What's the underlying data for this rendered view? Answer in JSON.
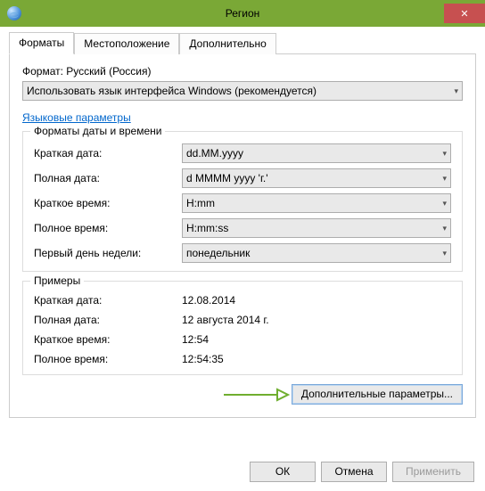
{
  "window": {
    "title": "Регион"
  },
  "tabs": [
    {
      "label": "Форматы",
      "active": true
    },
    {
      "label": "Местоположение",
      "active": false
    },
    {
      "label": "Дополнительно",
      "active": false
    }
  ],
  "formatHeader": "Формат: Русский (Россия)",
  "formatSelector": {
    "value": "Использовать язык интерфейса Windows (рекомендуется)"
  },
  "langLink": "Языковые параметры",
  "dtGroup": {
    "legend": "Форматы даты и времени",
    "rows": [
      {
        "label": "Краткая дата:",
        "value": "dd.MM.yyyy"
      },
      {
        "label": "Полная дата:",
        "value": "d MMMM yyyy 'г.'"
      },
      {
        "label": "Краткое время:",
        "value": "H:mm"
      },
      {
        "label": "Полное время:",
        "value": "H:mm:ss"
      },
      {
        "label": "Первый день недели:",
        "value": "понедельник"
      }
    ]
  },
  "examples": {
    "legend": "Примеры",
    "rows": [
      {
        "label": "Краткая дата:",
        "value": "12.08.2014"
      },
      {
        "label": "Полная дата:",
        "value": "12 августа 2014 г."
      },
      {
        "label": "Краткое время:",
        "value": "12:54"
      },
      {
        "label": "Полное время:",
        "value": "12:54:35"
      }
    ]
  },
  "additionalBtn": "Дополнительные параметры...",
  "footer": {
    "ok": "ОК",
    "cancel": "Отмена",
    "apply": "Применить"
  }
}
